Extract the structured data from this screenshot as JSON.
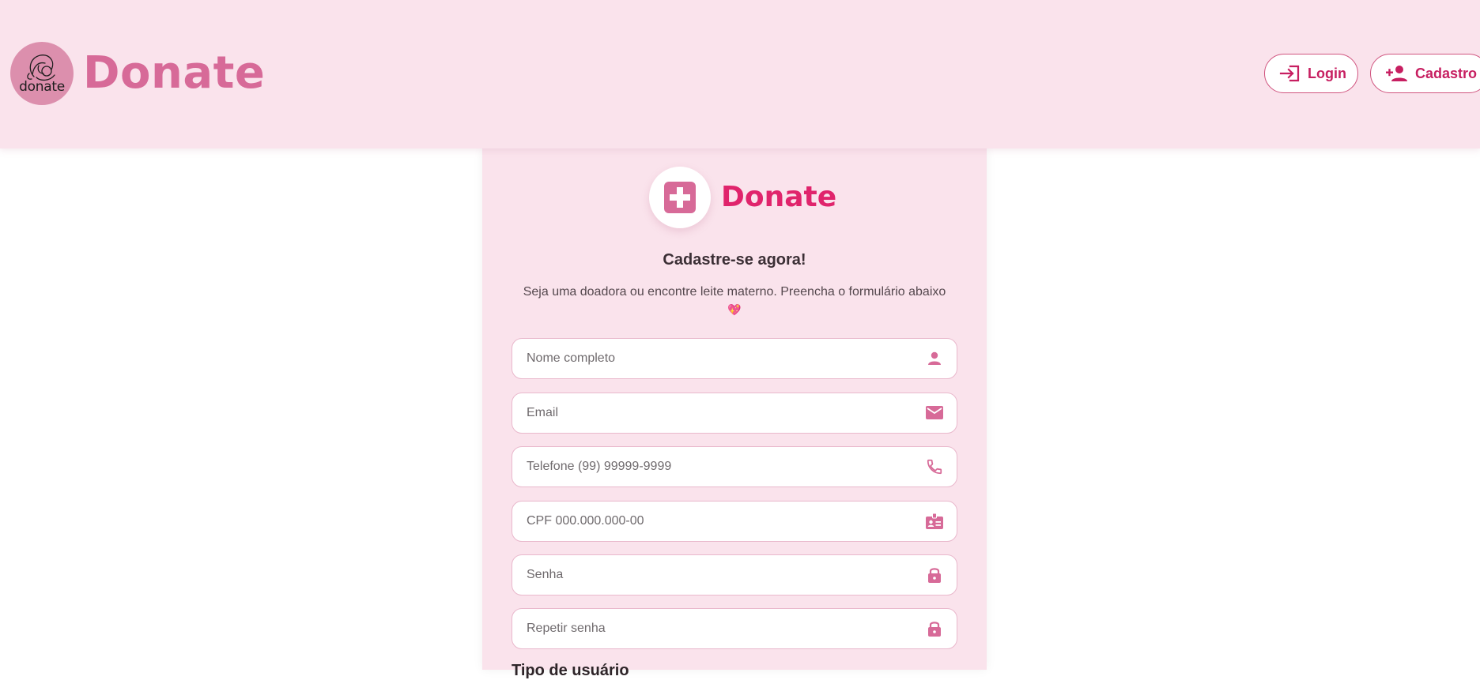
{
  "header": {
    "logo_text": "donate",
    "brand_name": "Donate",
    "login_label": "Login",
    "cadastro_label": "Cadastro"
  },
  "card": {
    "brand_name": "Donate",
    "title": "Cadastre-se agora!",
    "subtitle": "Seja uma doadora ou encontre leite materno. Preencha o formulário abaixo",
    "heart": "💖",
    "fields": [
      {
        "placeholder": "Nome completo",
        "icon": "person-icon"
      },
      {
        "placeholder": "Email",
        "icon": "email-icon"
      },
      {
        "placeholder": "Telefone (99) 99999-9999",
        "icon": "phone-icon"
      },
      {
        "placeholder": "CPF 000.000.000-00",
        "icon": "id-card-icon"
      },
      {
        "placeholder": "Senha",
        "icon": "lock-icon"
      },
      {
        "placeholder": "Repetir senha",
        "icon": "lock-icon"
      }
    ],
    "next_section_label": "Tipo de usuário"
  },
  "colors": {
    "header_bg": "#fae3ec",
    "brand_pink": "#d76a98",
    "accent": "#c71f61",
    "card_brand": "#e0246c",
    "icon": "#d76a98"
  }
}
